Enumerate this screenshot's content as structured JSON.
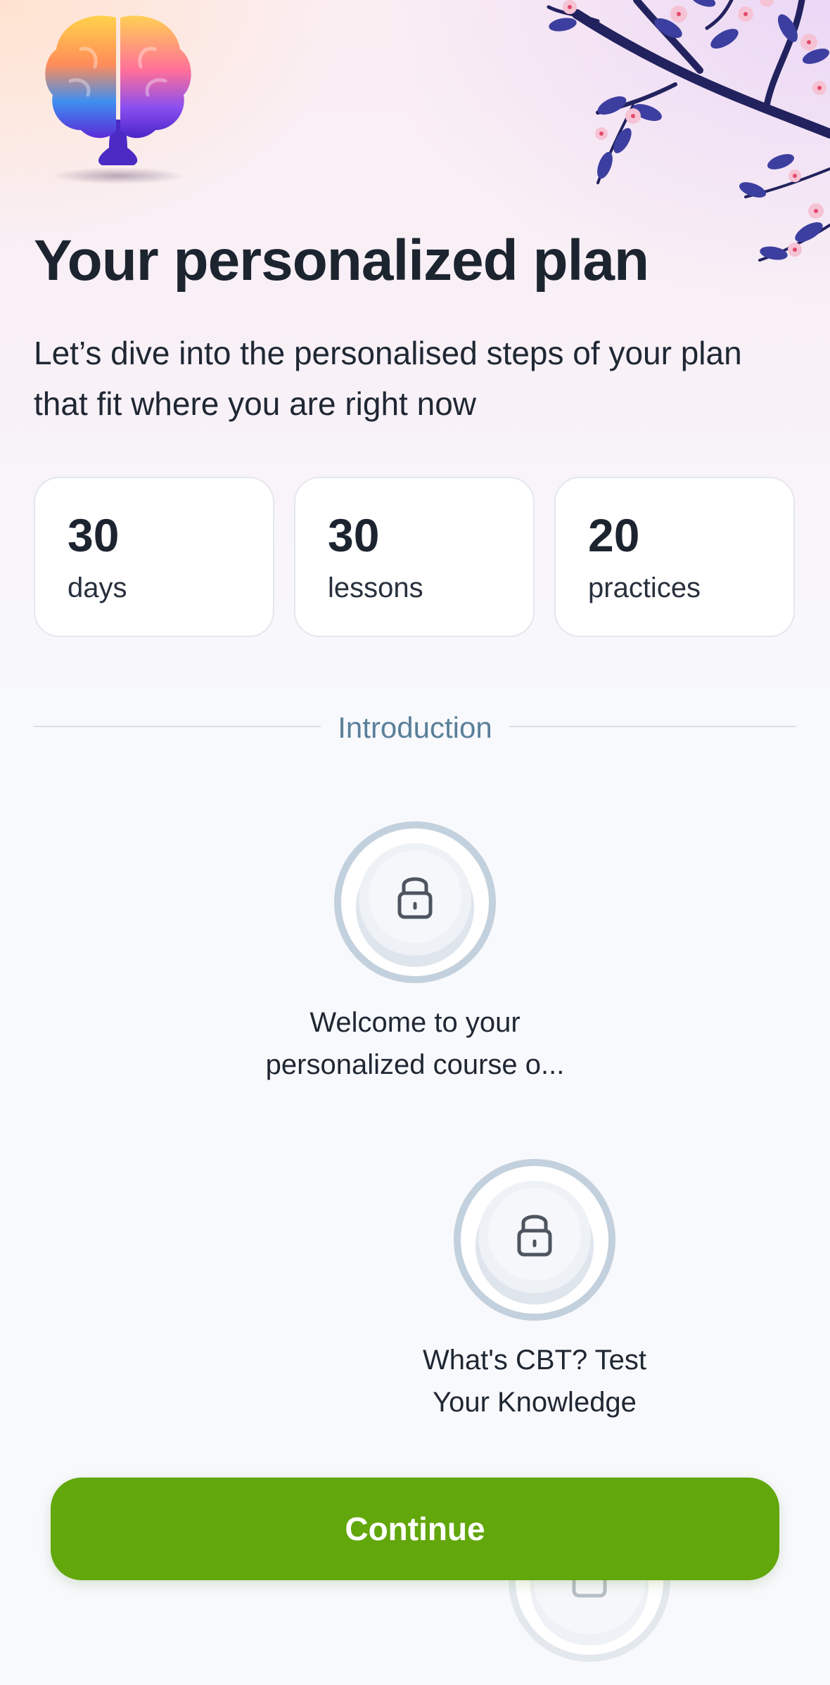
{
  "header": {
    "title": "Your personalized plan",
    "subtitle": "Let’s dive into the personalised steps of your plan that fit where you are right now"
  },
  "stats": [
    {
      "value": "30",
      "label": "days"
    },
    {
      "value": "30",
      "label": "lessons"
    },
    {
      "value": "20",
      "label": "practices"
    }
  ],
  "section": {
    "label": "Introduction"
  },
  "steps": [
    {
      "title": "Welcome to your personalized course o...",
      "status": "locked",
      "icon": "lock-icon"
    },
    {
      "title": "What's CBT? Test Your Knowledge",
      "status": "locked",
      "icon": "lock-icon"
    },
    {
      "title": "",
      "status": "locked",
      "icon": "lock-icon"
    }
  ],
  "cta": {
    "label": "Continue"
  },
  "colors": {
    "accent": "#62a70c",
    "section_label": "#5a7f99",
    "node_ring": "#c3d0dd",
    "title": "#1c2430"
  }
}
